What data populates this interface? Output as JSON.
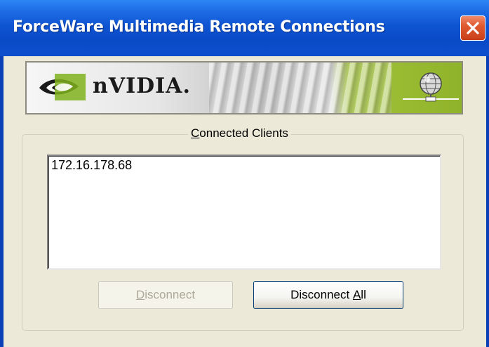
{
  "window": {
    "title": "ForceWare Multimedia Remote Connections"
  },
  "banner": {
    "brand": "nVIDIA.",
    "logo_icon": "nvidia-eye-icon",
    "globe_icon": "network-globe-icon",
    "accent_color": "#8fb32a"
  },
  "group": {
    "label_mnemonic": "C",
    "label_rest": "onnected Clients"
  },
  "clients": {
    "items": [
      "172.16.178.68"
    ]
  },
  "buttons": {
    "disconnect_mnemonic": "D",
    "disconnect_rest": "isconnect",
    "disconnect_all_prefix": "Disconnect ",
    "disconnect_all_mnemonic": "A",
    "disconnect_all_rest": "ll"
  },
  "colors": {
    "titlebar": "#0a4ac6",
    "close_button": "#e05a30",
    "dialog_background": "#ece9d8"
  }
}
